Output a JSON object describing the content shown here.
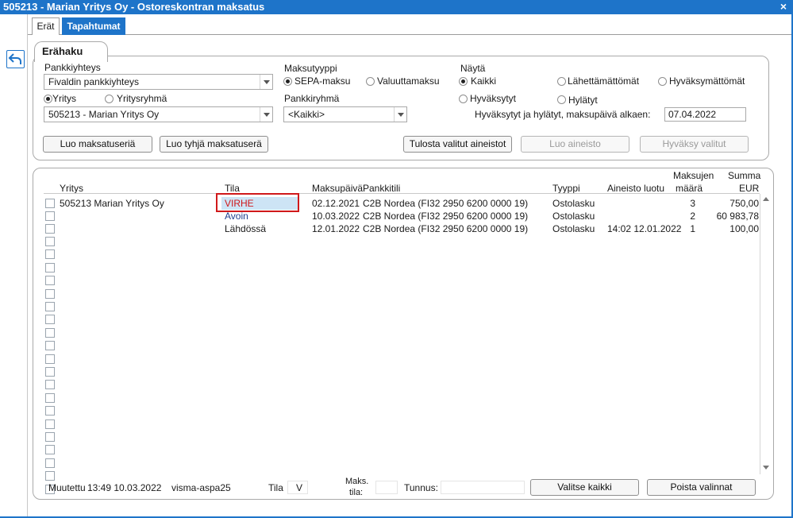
{
  "window": {
    "title": "505213 - Marian Yritys Oy - Ostoreskontran maksatus",
    "close": "×"
  },
  "tabs": [
    {
      "label": "Erät"
    },
    {
      "label": "Tapahtumat"
    }
  ],
  "search": {
    "title": "Erähaku",
    "pankkiyhteys_label": "Pankkiyhteys",
    "pankkiyhteys_value": "Fivaldin pankkiyhteys",
    "scope_yritys": "Yritys",
    "scope_yritysryhma": "Yritysryhmä",
    "company_value": "505213 - Marian Yritys Oy",
    "maksutyyppi_label": "Maksutyyppi",
    "sepa": "SEPA-maksu",
    "valuutta": "Valuuttamaksu",
    "pankkiryhma_label": "Pankkiryhmä",
    "pankkiryhma_value": "<Kaikki>",
    "nayta_label": "Näytä",
    "kaikki": "Kaikki",
    "lahettamattomat": "Lähettämättömät",
    "hyvaksymattomat": "Hyväksymättömät",
    "hyvaksytyt": "Hyväksytyt",
    "hylatyt": "Hylätyt",
    "date_label": "Hyväksytyt ja hylätyt, maksupäivä  alkaen:",
    "date_value": "07.04.2022"
  },
  "buttons": {
    "luo_maksatuseria": "Luo maksatuseriä",
    "luo_tyhja": "Luo tyhjä maksatuserä",
    "tulosta": "Tulosta valitut aineistot",
    "luo_aineisto": "Luo aineisto",
    "hyvaksy": "Hyväksy valitut",
    "valitse_kaikki": "Valitse kaikki",
    "poista_valinnat": "Poista valinnat"
  },
  "table": {
    "headers": {
      "yritys": "Yritys",
      "tila": "Tila",
      "maksupaiva": "Maksupäivä",
      "pankkitili": "Pankkitili",
      "tyyppi": "Tyyppi",
      "aineisto_luotu": "Aineisto luotu",
      "maksujen_1": "Maksujen",
      "maksujen_2": "määrä",
      "summa_1": "Summa",
      "summa_2": "EUR"
    },
    "rows": [
      {
        "yritys": "505213 Marian Yritys Oy",
        "tila": "VIRHE",
        "maksupaiva": "02.12.2021",
        "pankkitili": "C2B Nordea (FI32 2950 6200 0000 19)",
        "tyyppi": "Ostolasku",
        "aineisto_luotu": "",
        "maara": "3",
        "summa": "750,00"
      },
      {
        "yritys": "",
        "tila": "Avoin",
        "maksupaiva": "10.03.2022",
        "pankkitili": "C2B Nordea (FI32 2950 6200 0000 19)",
        "tyyppi": "Ostolasku",
        "aineisto_luotu": "",
        "maara": "2",
        "summa": "60 983,78"
      },
      {
        "yritys": "",
        "tila": "Lähdössä",
        "maksupaiva": "12.01.2022",
        "pankkitili": "C2B Nordea (FI32 2950 6200 0000 19)",
        "tyyppi": "Ostolasku",
        "aineisto_luotu": "14:02 12.01.2022",
        "maara": "1",
        "summa": "100,00"
      }
    ]
  },
  "footer": {
    "muutettu_label": "Muutettu",
    "muutettu_value": "13:49 10.03.2022",
    "user": "visma-aspa25",
    "tila_label": "Tila",
    "tila_value": "V",
    "maks_tila_1": "Maks.",
    "maks_tila_2": "tila:",
    "tunnus_label": "Tunnus:"
  },
  "colors": {
    "accent": "#1e74c9",
    "error": "#d0191b",
    "status_open": "#1f3f8f"
  },
  "icons": {
    "back": "back-arrow-icon"
  }
}
